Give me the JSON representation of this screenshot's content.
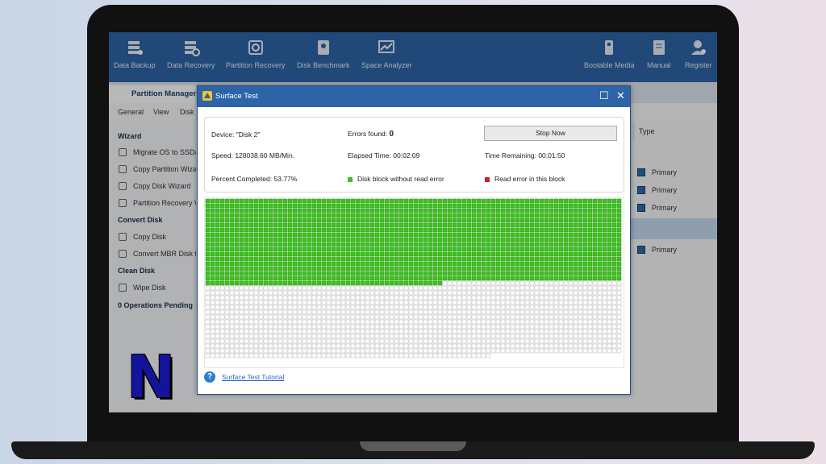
{
  "toolbar": {
    "items": [
      {
        "label": "Data Backup",
        "icon": "data-backup-icon"
      },
      {
        "label": "Data Recovery",
        "icon": "data-recovery-icon"
      },
      {
        "label": "Partition Recovery",
        "icon": "partition-recovery-icon"
      },
      {
        "label": "Disk Benchmark",
        "icon": "disk-benchmark-icon"
      },
      {
        "label": "Space Analyzer",
        "icon": "space-analyzer-icon"
      },
      {
        "label": "Bootable Media",
        "icon": "bootable-media-icon"
      },
      {
        "label": "Manual",
        "icon": "manual-icon"
      },
      {
        "label": "Register",
        "icon": "register-icon"
      }
    ]
  },
  "tabs": {
    "active": "Partition Management"
  },
  "menu": {
    "general": "General",
    "view": "View",
    "disk": "Disk"
  },
  "sidebar": {
    "wizard_heading": "Wizard",
    "wizard_items": [
      "Migrate OS to SSD/HD",
      "Copy Partition Wizard",
      "Copy Disk Wizard",
      "Partition Recovery Wizard"
    ],
    "convert_heading": "Convert Disk",
    "convert_items": [
      "Copy Disk",
      "Convert MBR Disk to GPT"
    ],
    "clean_heading": "Clean Disk",
    "clean_items": [
      "Wipe Disk"
    ],
    "pending": "0 Operations Pending"
  },
  "table": {
    "type_header": "Type",
    "rows": [
      "Primary",
      "Primary",
      "Primary",
      "Primary"
    ]
  },
  "dialog": {
    "title": "Surface Test",
    "device_label": "Device:",
    "device_value": "\"Disk 2\"",
    "errors_label": "Errors found:",
    "errors_value": "0",
    "stop_button": "Stop Now",
    "speed_label": "Speed:",
    "speed_value": "128038.60 MB/Min.",
    "elapsed_label": "Elapsed Time:",
    "elapsed_value": "00:02:09",
    "remaining_label": "Time Remaining:",
    "remaining_value": "00:01:50",
    "percent_label": "Percent Completed:",
    "percent_value": "53.77%",
    "legend_ok": "Disk block without read error",
    "legend_err": "Read error in this block",
    "tutorial_link": "Surface Test Tutorial"
  },
  "colors": {
    "brand_blue": "#2d64a8",
    "block_ok": "#3fc21f",
    "block_error": "#d62020"
  }
}
